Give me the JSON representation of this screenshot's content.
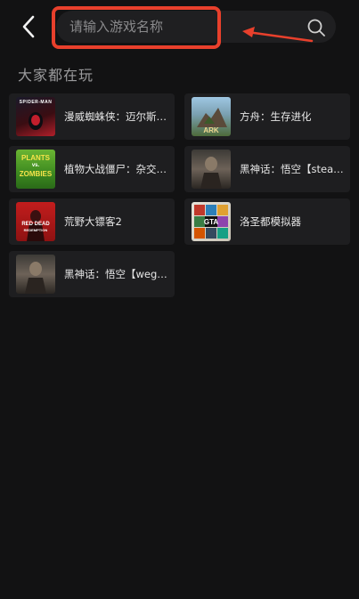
{
  "header": {
    "search_placeholder": "请输入游戏名称"
  },
  "section": {
    "title": "大家都在玩"
  },
  "games": [
    {
      "name": "漫威蜘蛛侠：迈尔斯.莫...",
      "icon": "spiderman-cover"
    },
    {
      "name": "方舟：生存进化",
      "icon": "ark-cover"
    },
    {
      "name": "植物大战僵尸：杂交版...",
      "icon": "pvz-cover"
    },
    {
      "name": "黑神话：悟空【steam...",
      "icon": "wukong-cover"
    },
    {
      "name": "荒野大镖客2",
      "icon": "rdr2-cover"
    },
    {
      "name": "洛圣都模拟器",
      "icon": "gta-cover"
    },
    {
      "name": "黑神话：悟空【wegam...",
      "icon": "wukong-cover"
    }
  ],
  "colors": {
    "background": "#121213",
    "card": "#1e1e20",
    "annotation": "#e8402c"
  }
}
